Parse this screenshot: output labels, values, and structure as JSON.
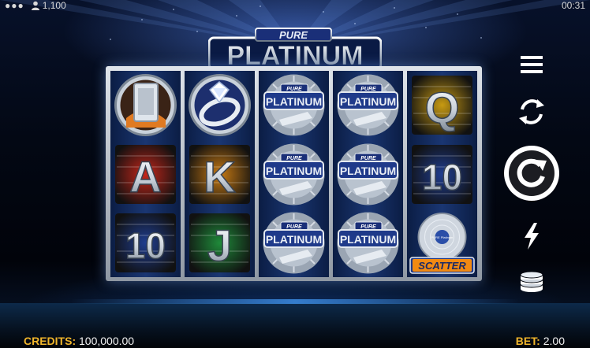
{
  "status": {
    "balance": "1,100",
    "time": "00:31"
  },
  "logo": {
    "small_text": "PURE",
    "big_text": "PLATINUM"
  },
  "reels": [
    [
      {
        "symbol": "platinum-bar"
      },
      {
        "symbol": "A",
        "bg": "#c4261a"
      },
      {
        "symbol": "10",
        "bg": "#1f3d8f"
      }
    ],
    [
      {
        "symbol": "diamond-ring"
      },
      {
        "symbol": "K",
        "bg": "#c87a12"
      },
      {
        "symbol": "J",
        "bg": "#1f8a3a"
      }
    ],
    [
      {
        "symbol": "wild-logo",
        "label": "PLATINUM",
        "sub": "PURE"
      },
      {
        "symbol": "wild-logo",
        "label": "PLATINUM",
        "sub": "PURE"
      },
      {
        "symbol": "wild-logo",
        "label": "PLATINUM",
        "sub": "PURE"
      }
    ],
    [
      {
        "symbol": "wild-logo",
        "label": "PLATINUM",
        "sub": "PURE"
      },
      {
        "symbol": "wild-logo",
        "label": "PLATINUM",
        "sub": "PURE"
      },
      {
        "symbol": "wild-logo",
        "label": "PLATINUM",
        "sub": "PURE"
      }
    ],
    [
      {
        "symbol": "Q",
        "bg": "#c79a12"
      },
      {
        "symbol": "10",
        "bg": "#1f3d8f"
      },
      {
        "symbol": "scatter-record",
        "label": "SCATTER",
        "disc_text": "PURE Platinum"
      }
    ]
  ],
  "controls": [
    {
      "name": "menu-icon"
    },
    {
      "name": "autoplay-icon"
    },
    {
      "name": "spin-icon"
    },
    {
      "name": "turbo-icon"
    },
    {
      "name": "bet-coins-icon"
    }
  ],
  "footer": {
    "credits_label": "CREDITS:",
    "credits_value": "100,000.00",
    "bet_label": "BET:",
    "bet_value": "2.00"
  },
  "colors": {
    "accent": "#f1b62b",
    "reel_bg": "#1a3672",
    "scatter_banner": "#f28a12"
  }
}
